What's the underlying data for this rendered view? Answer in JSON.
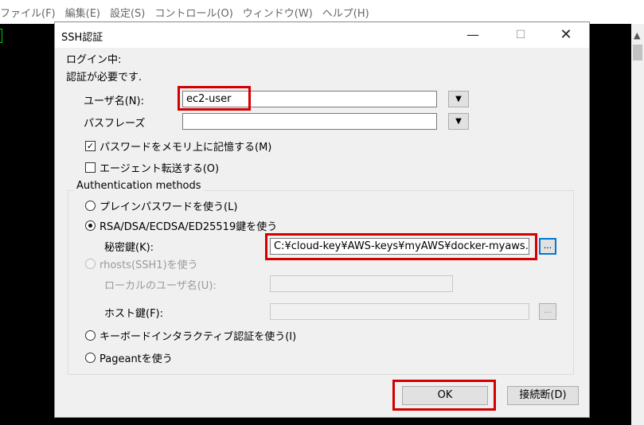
{
  "menu": [
    "ファイル(F)",
    "編集(E)",
    "設定(S)",
    "コントロール(O)",
    "ウィンドウ(W)",
    "ヘルプ(H)"
  ],
  "dialog": {
    "title": "SSH認証",
    "login_status": "ログイン中:",
    "auth_required": "認証が必要です.",
    "username_label": "ユーザ名(N):",
    "username_value": "ec2-user",
    "passphrase_label": "パスフレーズ",
    "passphrase_value": "",
    "remember_password_label": "パスワードをメモリ上に記憶する(M)",
    "remember_password_checked": true,
    "agent_forward_label": "エージェント転送する(O)",
    "agent_forward_checked": false,
    "auth_methods_title": "Authentication methods",
    "plain_password_label": "プレインパスワードを使う(L)",
    "rsa_key_label": "RSA/DSA/ECDSA/ED25519鍵を使う",
    "private_key_label": "秘密鍵(K):",
    "private_key_value": "C:¥cloud-key¥AWS-keys¥myAWS¥docker-myaws.",
    "browse_label": "...",
    "rhosts_label": "rhosts(SSH1)を使う",
    "local_username_label": "ローカルのユーザ名(U):",
    "host_key_label": "ホスト鍵(F):",
    "keyboard_interactive_label": "キーボードインタラクティブ認証を使う(I)",
    "pageant_label": "Pageantを使う",
    "ok_label": "OK",
    "disconnect_label": "接続断(D)",
    "selected_method": "rsa_key"
  },
  "colors": {
    "highlight_border": "#d40000",
    "focus_border": "#0078d7"
  }
}
